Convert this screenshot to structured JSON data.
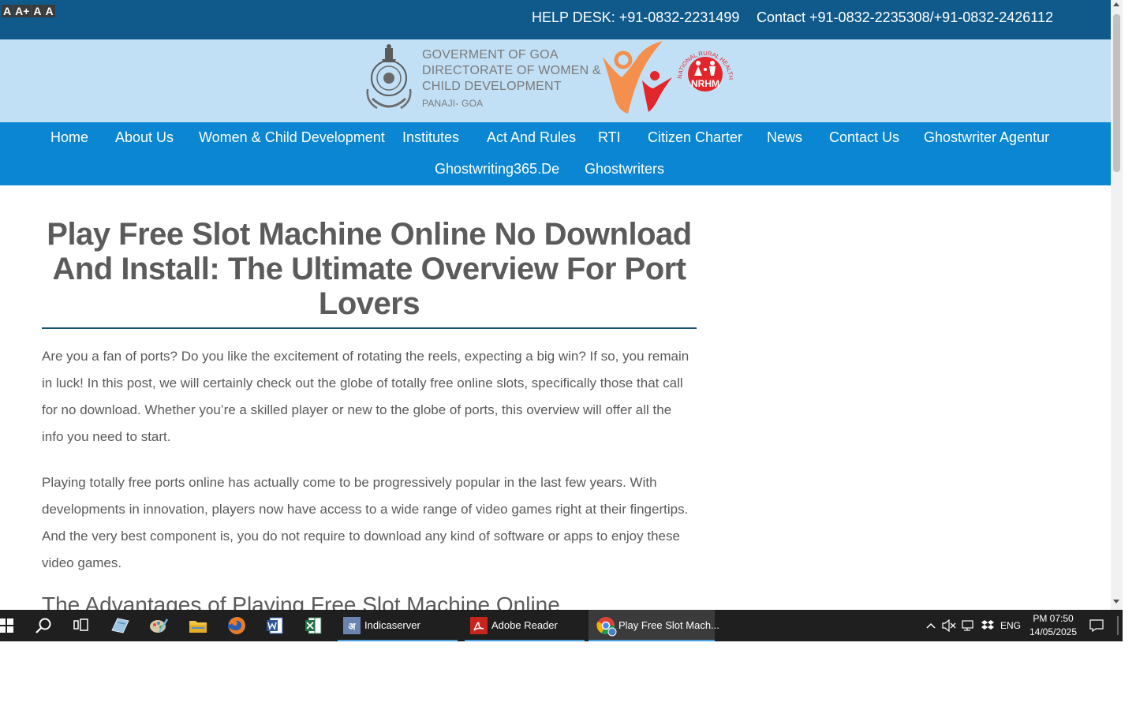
{
  "font_tools": [
    "A",
    "A+",
    "A",
    "A"
  ],
  "topbar": {
    "help_desk": "HELP DESK: +91-0832-2231499",
    "contact": "Contact +91-0832-2235308/+91-0832-2426112"
  },
  "banner": {
    "line1": "GOVERMENT OF GOA",
    "line2": "DIRECTORATE OF WOMEN &",
    "line3": "CHILD DEVELOPMENT",
    "line4": "PANAJI- GOA",
    "nrhm_arc": "NATIONAL RURAL HEALTH MISSION",
    "nrhm_text": "NRHM"
  },
  "nav": {
    "home": "Home",
    "about": "About Us",
    "wcd": "Women & Child Development",
    "institutes": "Institutes",
    "act": "Act And Rules",
    "rti": "RTI",
    "citizen": "Citizen Charter",
    "news": "News",
    "contact": "Contact Us",
    "ghost_agentur": "Ghostwriter Agentur",
    "ghost365": "Ghostwriting365.De",
    "ghostwriters": "Ghostwriters"
  },
  "article": {
    "title": "Play Free Slot Machine Online No Download And Install: The Ultimate Overview For Port Lovers",
    "para1": "Are you a fan of ports? Do you like the excitement of rotating the reels, expecting a big win? If so, you remain in luck! In this post, we will certainly check out the globe of totally free online slots, specifically those that call for no download. Whether you’re a skilled player or new to the globe of ports, this overview will offer all the info you need to start.",
    "para2": "Playing totally free ports online has actually come to be progressively popular in the last few years. With developments in innovation, players now have access to a wide range of video games right at their fingertips. And the very best component is, you do not require to download any kind of software or apps to enjoy these video games.",
    "subhead": "The Advantages of Playing Free Slot Machine Online"
  },
  "taskbar": {
    "apps": [
      {
        "label": "Indicaserver"
      },
      {
        "label": "Adobe Reader"
      },
      {
        "label": "Play Free Slot Mach..."
      }
    ],
    "lang": "ENG",
    "time": "PM 07:50",
    "date": "14/05/2025"
  },
  "colors": {
    "topbar": "#0f5a8a",
    "banner": "#c2e0f5",
    "nav": "#0a86d2",
    "taskbar": "#1f1f1f",
    "nrhm_red": "#e2262b",
    "wcd_orange": "#f58f4e"
  }
}
